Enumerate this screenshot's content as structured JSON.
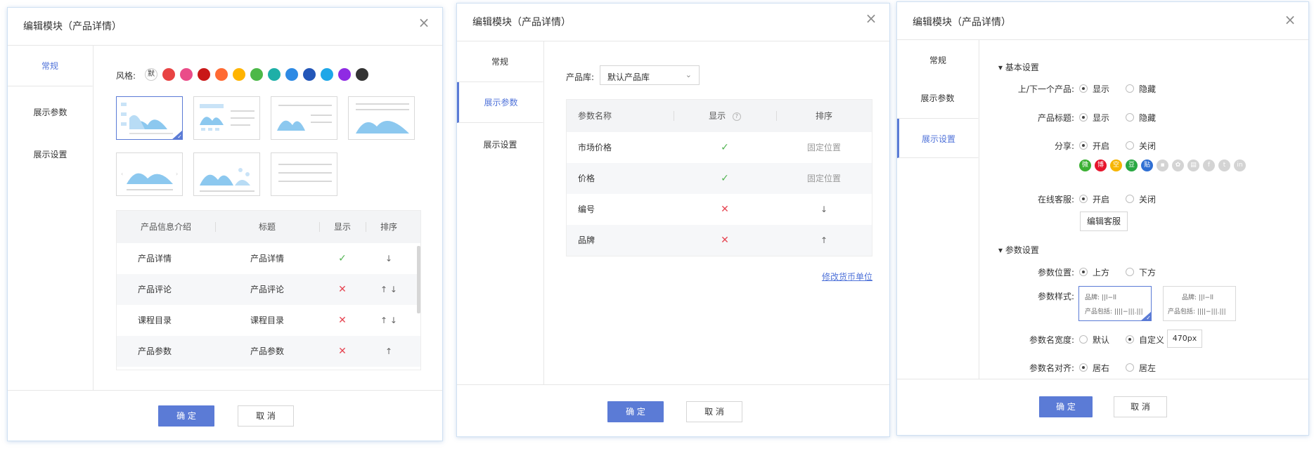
{
  "dialog_title": "编辑模块（产品详情）",
  "close_glyph": "×",
  "confirm_label": "确 定",
  "cancel_label": "取 消",
  "sidebar": {
    "general": "常规",
    "display_params": "展示参数",
    "display_settings": "展示设置"
  },
  "panel1": {
    "style_label": "风格:",
    "default_swatch": "默",
    "swatches": [
      "#e84343",
      "#ea4c89",
      "#c91818",
      "#ff6a33",
      "#ffb400",
      "#4cb848",
      "#1eafa7",
      "#2d8ae4",
      "#2356b8",
      "#1ea7e8",
      "#8f2be3",
      "#333333"
    ],
    "table": {
      "headers": [
        "产品信息介绍",
        "标题",
        "显示",
        "排序"
      ],
      "rows": [
        {
          "name": "产品详情",
          "title": "产品详情",
          "show": "✓",
          "sort": "↓"
        },
        {
          "name": "产品评论",
          "title": "产品评论",
          "show": "✕",
          "sort": "↑ ↓"
        },
        {
          "name": "课程目录",
          "title": "课程目录",
          "show": "✕",
          "sort": "↑ ↓"
        },
        {
          "name": "产品参数",
          "title": "产品参数",
          "show": "✕",
          "sort": "↑"
        }
      ]
    }
  },
  "panel2": {
    "library_label": "产品库:",
    "library_value": "默认产品库",
    "table": {
      "headers": [
        "参数名称",
        "显示",
        "排序"
      ],
      "help_glyph": "?",
      "rows": [
        {
          "name": "市场价格",
          "show": "✓",
          "sort": "固定位置"
        },
        {
          "name": "价格",
          "show": "✓",
          "sort": "固定位置"
        },
        {
          "name": "编号",
          "show": "✕",
          "sort": "↓"
        },
        {
          "name": "品牌",
          "show": "✕",
          "sort": "↑"
        }
      ]
    },
    "currency_link": "修改货币单位"
  },
  "panel3": {
    "basic_section": "基本设置",
    "prev_next_label": "上/下一个产品:",
    "product_title_label": "产品标题:",
    "share_label": "分享:",
    "online_service_label": "在线客服:",
    "show": "显示",
    "hide": "隐藏",
    "on": "开启",
    "off": "关闭",
    "edit_service_button": "编辑客服",
    "share_icons": [
      {
        "glyph": "微",
        "color": "#3cb034"
      },
      {
        "glyph": "博",
        "color": "#e6162d"
      },
      {
        "glyph": "空",
        "color": "#f6b500"
      },
      {
        "glyph": "豆",
        "color": "#2aa843"
      },
      {
        "glyph": "贴",
        "color": "#2f6fd3"
      },
      {
        "glyph": "▪",
        "color": "#d4d4d4"
      },
      {
        "glyph": "✿",
        "color": "#d4d4d4"
      },
      {
        "glyph": "▤",
        "color": "#d4d4d4"
      },
      {
        "glyph": "f",
        "color": "#d4d4d4"
      },
      {
        "glyph": "t",
        "color": "#d4d4d4"
      },
      {
        "glyph": "in",
        "color": "#d4d4d4"
      }
    ],
    "param_section": "参数设置",
    "param_position_label": "参数位置:",
    "top": "上方",
    "bottom": "下方",
    "param_style_label": "参数样式:",
    "style_sample_brand": "品牌: ||l−ll",
    "style_sample_package": "产品包括: ||||−|||.|||",
    "param_width_label": "参数名宽度:",
    "default": "默认",
    "custom": "自定义",
    "width_value": "470px",
    "param_align_label": "参数名对齐:",
    "align_right": "居右",
    "align_left": "居左"
  }
}
